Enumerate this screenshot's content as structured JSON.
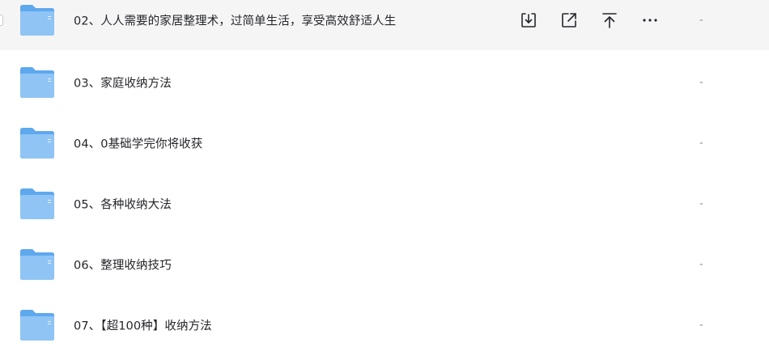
{
  "colors": {
    "hover_row_bg": "#f5f5f6",
    "folder_body": "#8fc4f5",
    "folder_tab": "#5ea8ee",
    "text": "#25262b",
    "muted": "#878c9c"
  },
  "files": [
    {
      "name": "02、人人需要的家居整理术，过简单生活，享受高效舒适人生",
      "size": "-",
      "icon": "folder-icon",
      "hovered": true
    },
    {
      "name": "03、家庭收纳方法",
      "size": "-",
      "icon": "folder-icon"
    },
    {
      "name": "04、0基础学完你将收获",
      "size": "-",
      "icon": "folder-icon"
    },
    {
      "name": "05、各种收纳大法",
      "size": "-",
      "icon": "folder-icon"
    },
    {
      "name": "06、整理收纳技巧",
      "size": "-",
      "icon": "folder-icon"
    },
    {
      "name": "07、【超100种】收纳方法",
      "size": "-",
      "icon": "folder-icon"
    }
  ],
  "row_actions": [
    {
      "icon": "download-icon"
    },
    {
      "icon": "share-icon"
    },
    {
      "icon": "pin-to-top-icon"
    },
    {
      "icon": "more-icon"
    }
  ]
}
